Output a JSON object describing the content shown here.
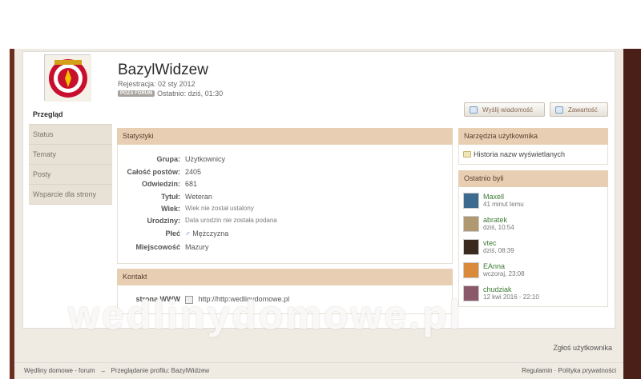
{
  "profile": {
    "name": "BazylWidzew",
    "joined": "Rejestracja: 02 sty 2012",
    "badge": "POZA FORUM",
    "last_seen": "Ostatnio: dziś, 01:30"
  },
  "nav": [
    "Przegląd",
    "Status",
    "Tematy",
    "Posty",
    "Wsparcie dla strony"
  ],
  "buttons": {
    "message": "Wyślij wiadomość",
    "content": "Zawartość"
  },
  "stats": {
    "title": "Statystyki",
    "rows": [
      {
        "label": "Grupa:",
        "value": "Użytkownicy"
      },
      {
        "label": "Całość postów:",
        "value": "2405"
      },
      {
        "label": "Odwiedzin:",
        "value": "681"
      },
      {
        "label": "Tytuł:",
        "value": "Weteran"
      },
      {
        "label": "Wiek:",
        "value": "Wiek nie został ustalony"
      },
      {
        "label": "Urodziny:",
        "value": "Data urodzin nie została podana"
      },
      {
        "label": "Płeć",
        "value": "Mężczyzna"
      },
      {
        "label": "Miejscowość",
        "value": "Mazury"
      }
    ]
  },
  "contact": {
    "title": "Kontakt",
    "label": "strona WWW",
    "value": "http://http:wedlinydomowe.pl"
  },
  "tools": {
    "title": "Narzędzia użytkownika",
    "item": "Historia nazw wyświetlanych"
  },
  "visitors": {
    "title": "Ostatnio byli",
    "items": [
      {
        "name": "Maxell",
        "time": "41 minut temu"
      },
      {
        "name": "abratek",
        "time": "dziś, 10:54"
      },
      {
        "name": "vtec",
        "time": "dziś, 08:39"
      },
      {
        "name": "EAnna",
        "time": "wczoraj, 23:08"
      },
      {
        "name": "chudziak",
        "time": "12 kwi 2016 - 22:10"
      }
    ]
  },
  "watermark": "wedlinydomowe.pl",
  "report": "Zgłoś użytkownika",
  "footer": {
    "crumb1": "Wędliny domowe - forum",
    "arrow": "→",
    "crumb2": "Przeglądanie profilu: BazylWidzew",
    "links": "Regulamin · Polityka prywatności"
  }
}
